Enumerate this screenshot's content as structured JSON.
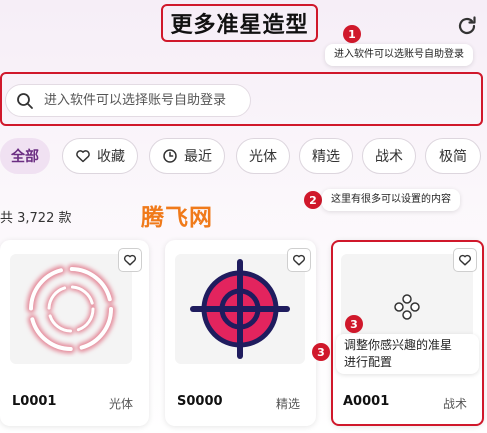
{
  "header": {
    "title": "更多准星造型",
    "refresh_icon": "refresh-icon"
  },
  "annotations": [
    {
      "num": "1",
      "text": "进入软件可以选账号自助登录"
    },
    {
      "num": "2",
      "text": "这里有很多可以设置的内容"
    },
    {
      "num": "3",
      "text": "调整你感兴趣的准星进行配置"
    }
  ],
  "annotation3_lines": [
    "调整你感兴趣的准星",
    "进行配置"
  ],
  "search": {
    "placeholder": "进入软件可以选择账号自助登录",
    "icon": "search-icon"
  },
  "filters": [
    {
      "label": "全部",
      "active": true
    },
    {
      "label": "收藏",
      "icon": "heart-icon"
    },
    {
      "label": "最近",
      "icon": "clock-icon"
    },
    {
      "label": "光体"
    },
    {
      "label": "精选"
    },
    {
      "label": "战术"
    },
    {
      "label": "极简"
    }
  ],
  "count_text": "共 3,722 款",
  "watermark": "腾飞网",
  "cards": [
    {
      "id": "L0001",
      "tag": "光体",
      "icon": "ring-crosshair-icon"
    },
    {
      "id": "S0000",
      "tag": "精选",
      "icon": "target-crosshair-icon"
    },
    {
      "id": "A0001",
      "tag": "战术",
      "icon": "dots-crosshair-icon"
    }
  ],
  "colors": {
    "accent": "#d0182b",
    "chip_active_bg": "#f0e1f2",
    "watermark": "#f07a1a",
    "crosshair_pink": "#e3245e",
    "crosshair_navy": "#1f1c5e"
  }
}
